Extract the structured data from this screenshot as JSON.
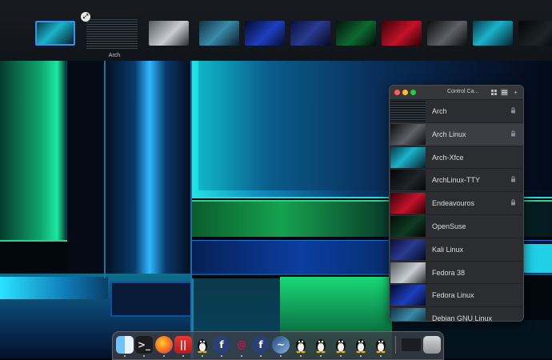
{
  "spaces": {
    "active_label": "Arch",
    "thumbnails": [
      {
        "name": "desktop-1",
        "style": "teal",
        "active": true
      },
      {
        "name": "arch",
        "style": "terminal",
        "active": false
      },
      {
        "name": "desktop-3",
        "style": "grey",
        "active": false
      },
      {
        "name": "desktop-4",
        "style": "mint",
        "active": false
      },
      {
        "name": "desktop-5",
        "style": "blue",
        "active": false
      },
      {
        "name": "desktop-6",
        "style": "navy",
        "active": false
      },
      {
        "name": "desktop-7",
        "style": "green",
        "active": false
      },
      {
        "name": "desktop-8",
        "style": "red",
        "active": false
      },
      {
        "name": "desktop-9",
        "style": "dark",
        "active": false
      },
      {
        "name": "desktop-10",
        "style": "teal",
        "active": false
      },
      {
        "name": "desktop-11",
        "style": "black",
        "active": false
      }
    ],
    "close_glyph": "⤢"
  },
  "control_center": {
    "title": "Control Ca...",
    "add_glyph": "+",
    "items": [
      {
        "label": "Arch",
        "locked": true,
        "selected": false,
        "thumb": "terminal"
      },
      {
        "label": "Arch Linux",
        "locked": true,
        "selected": true,
        "thumb": "dark"
      },
      {
        "label": "Arch-Xfce",
        "locked": false,
        "selected": false,
        "thumb": "teal"
      },
      {
        "label": "ArchLinux-TTY",
        "locked": true,
        "selected": false,
        "thumb": "black"
      },
      {
        "label": "Endeavouros",
        "locked": true,
        "selected": false,
        "thumb": "red"
      },
      {
        "label": "OpenSuse",
        "locked": false,
        "selected": false,
        "thumb": "darkgreen"
      },
      {
        "label": "Kali Linux",
        "locked": false,
        "selected": false,
        "thumb": "navy"
      },
      {
        "label": "Fedora 38",
        "locked": false,
        "selected": false,
        "thumb": "grey"
      },
      {
        "label": "Fedora Linux",
        "locked": false,
        "selected": false,
        "thumb": "blue"
      },
      {
        "label": "Debian GNU Linux",
        "locked": false,
        "selected": false,
        "thumb": "mint"
      }
    ]
  },
  "dock": {
    "apps": [
      {
        "name": "finder",
        "running": true
      },
      {
        "name": "terminal",
        "running": true
      },
      {
        "name": "firefox",
        "running": true
      },
      {
        "name": "parallels",
        "running": true
      },
      {
        "name": "tux-vm-1",
        "running": true
      },
      {
        "name": "fedora-vm-1",
        "running": true
      },
      {
        "name": "debian-vm",
        "running": true
      },
      {
        "name": "fedora-vm-2",
        "running": true
      },
      {
        "name": "kali-vm",
        "running": true
      },
      {
        "name": "tux-vm-2",
        "running": true
      },
      {
        "name": "tux-vm-3",
        "running": true
      },
      {
        "name": "tux-vm-4",
        "running": true
      },
      {
        "name": "tux-vm-5",
        "running": true
      },
      {
        "name": "tux-vm-6",
        "running": true
      },
      {
        "name": "desktop-folder",
        "running": false
      },
      {
        "name": "trash",
        "running": false
      }
    ]
  }
}
